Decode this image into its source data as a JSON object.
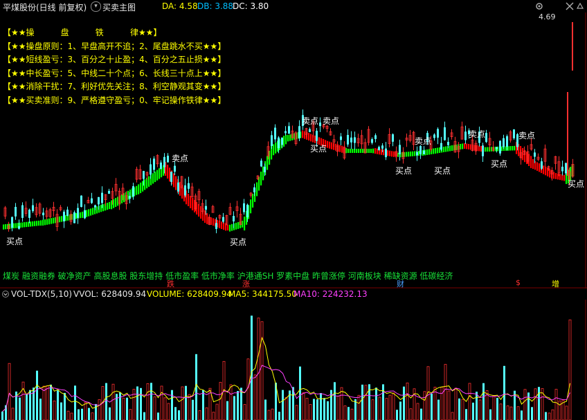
{
  "header": {
    "stock_title": "平煤股份(日线 前复权)",
    "indicator_name": "买卖主图",
    "da_label": "DA: 4.58",
    "db_label": "DB: 3.88",
    "dc_label": "DC: 3.80",
    "dropdown_icon": "chevron-down-icon",
    "window_icons": [
      "settings-icon",
      "close-icon",
      "expand-icon"
    ]
  },
  "price_tag": "4.69",
  "rules": [
    "【★★操          盘          铁          律★★】",
    "【★★操盘原则：1、早盘高开不追；2、尾盘跳水不买★★】",
    "【★★短线盈亏：3、百分之十止盈；4、百分之五止损★★】",
    "【★★中长盈亏：5、中线二十个点；6、长线三十点上★★】",
    "【★★消除干扰：7、利好优先关注；8、利空静观其变★★】",
    "【★★买卖准则：9、严格遵守盈亏；0、牢记操作铁律★★】"
  ],
  "concepts": "煤炭 融资融券 破净资产 高股息股 股东增持 低市盈率 低市净率 沪港通SH 罗素中盘 昨曾涨停 河南板块 稀缺资源 低碳经济",
  "markers": [
    {
      "text": "跌",
      "color": "#ff3030"
    },
    {
      "text": "涨",
      "color": "#ff3030"
    },
    {
      "text": "财",
      "color": "#4aa0ff"
    },
    {
      "text": "$",
      "color": "#ff3030"
    },
    {
      "text": "增",
      "color": "#ffff00"
    }
  ],
  "signals": {
    "buy": "买点",
    "sell": "卖点"
  },
  "volume_legend": {
    "name": "VOL-TDX(5,10)",
    "vvol": "VVOL: 628409.94",
    "volume": "VOLUME: 628409.94",
    "ma5": "MA5: 344175.50",
    "ma10": "MA10: 224232.13"
  },
  "colors": {
    "up": "#ff3030",
    "down": "#54ffff",
    "trend_up": "#00ff00",
    "trend_down": "#ff0000",
    "ma5": "#ffff00",
    "ma10": "#ff40ff"
  }
}
